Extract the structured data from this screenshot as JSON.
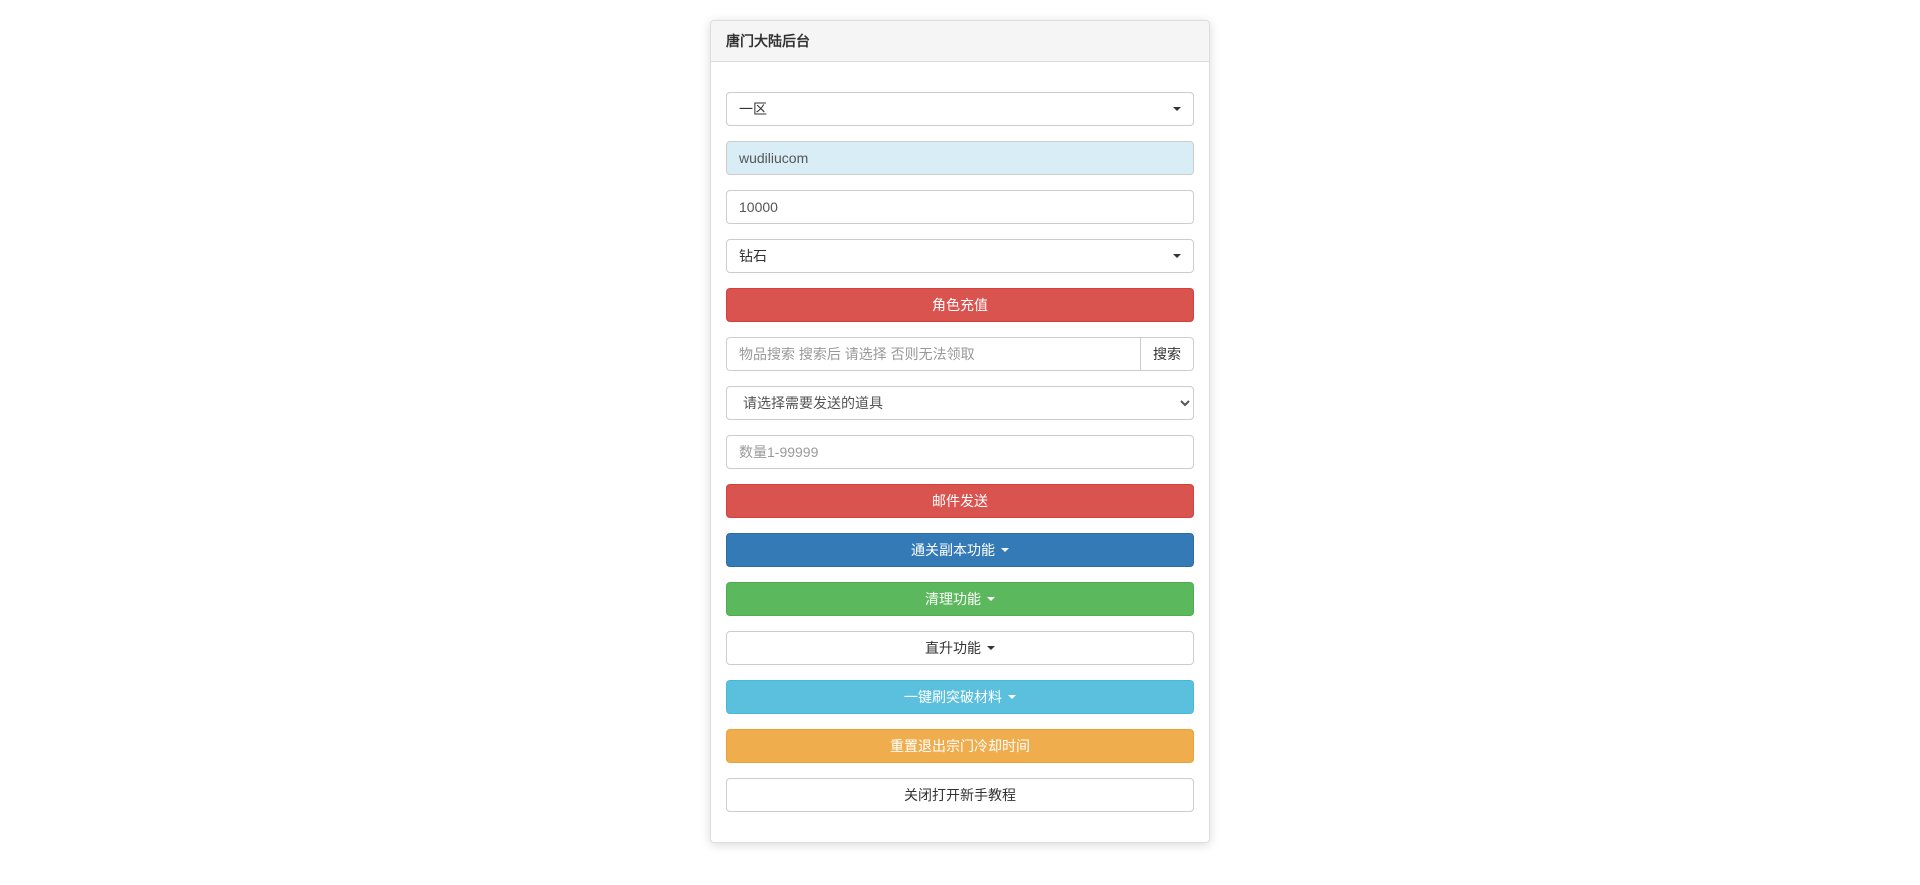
{
  "panel": {
    "title": "唐门大陆后台"
  },
  "form": {
    "zone_select": {
      "selected": "一区"
    },
    "account_input": {
      "value": "wudiliucom"
    },
    "amount_input": {
      "value": "10000"
    },
    "currency_select": {
      "selected": "钻石"
    },
    "recharge_button": "角色充值",
    "item_search": {
      "placeholder": "物品搜索 搜索后 请选择 否则无法领取",
      "search_button": "搜索"
    },
    "item_select": {
      "placeholder": "请选择需要发送的道具"
    },
    "quantity_input": {
      "placeholder": "数量1-99999"
    },
    "mail_send_button": "邮件发送",
    "dungeon_button": "通关副本功能",
    "cleanup_button": "清理功能",
    "upgrade_button": "直升功能",
    "material_button": "一键刷突破材料",
    "reset_button": "重置退出宗门冷却时间",
    "tutorial_button": "关闭打开新手教程"
  }
}
